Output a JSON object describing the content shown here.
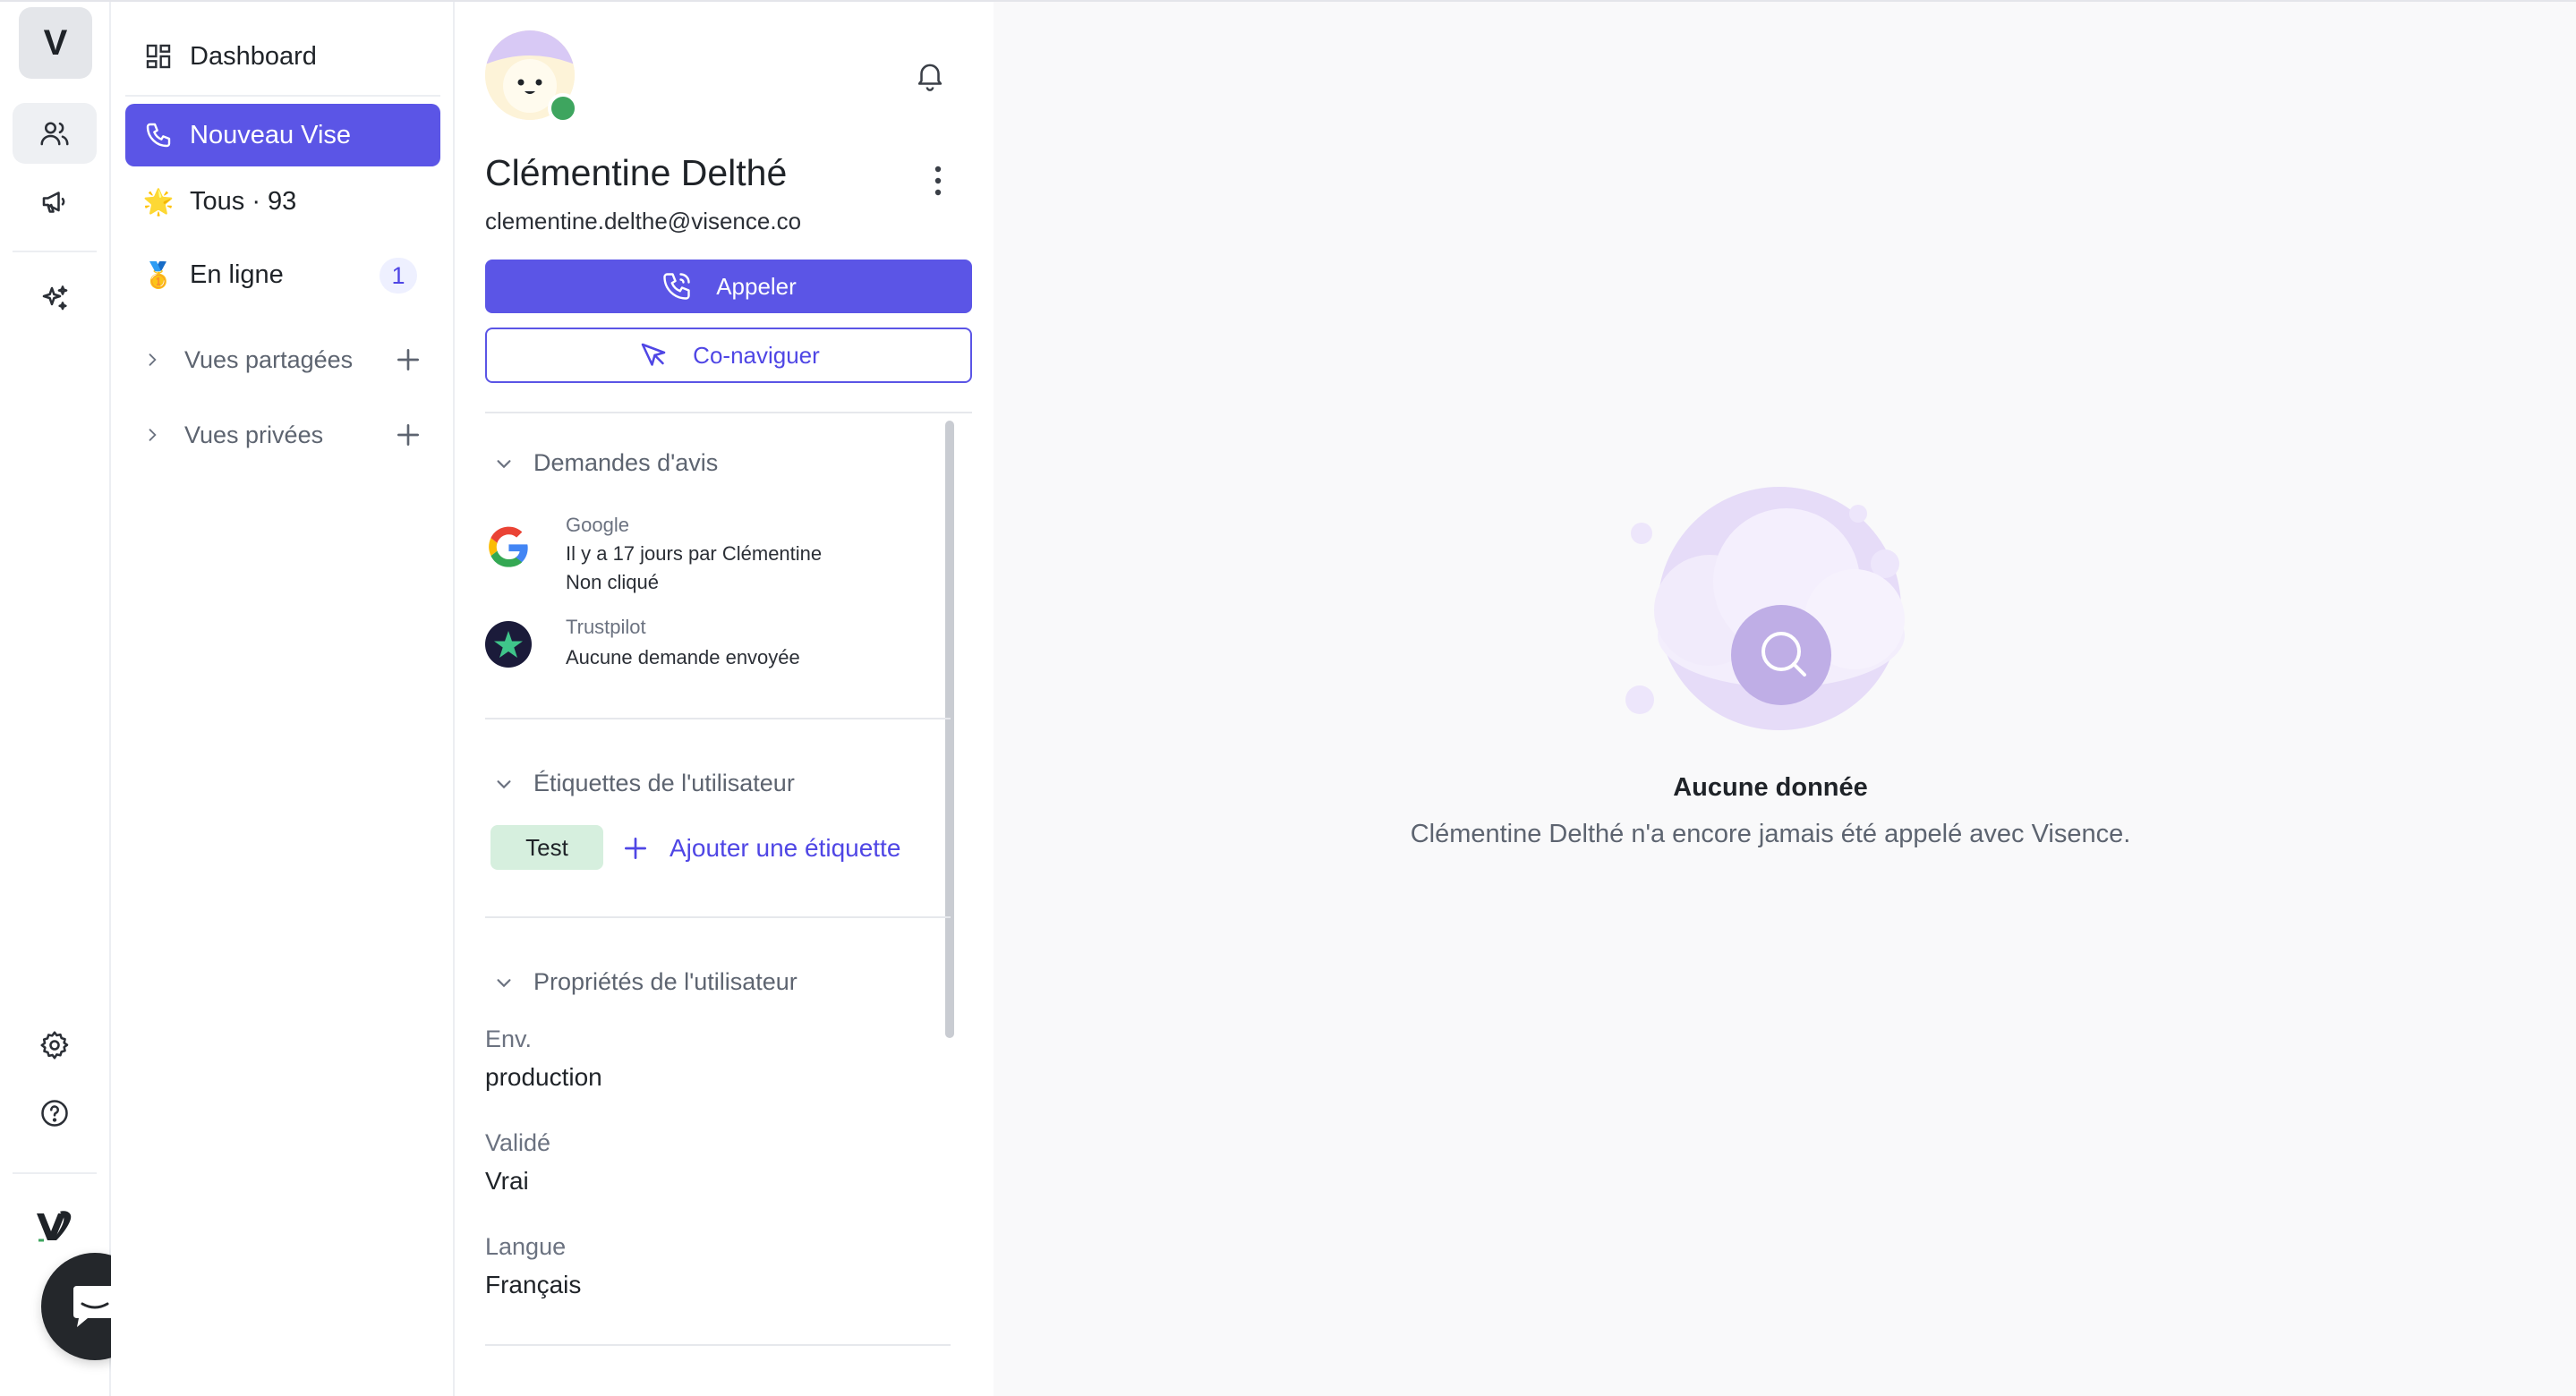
{
  "rail": {
    "logo_letter": "V",
    "icons": [
      "users-icon",
      "megaphone-icon",
      "sparkles-icon",
      "settings-icon",
      "help-icon"
    ],
    "brand_icon": "visence-logo-icon",
    "chat_icon": "chat-bubble-icon"
  },
  "nav": {
    "dashboard": "Dashboard",
    "new_vise": "Nouveau Vise",
    "all": "Tous · 93",
    "online": "En ligne",
    "online_count": "1",
    "shared_views": "Vues partagées",
    "private_views": "Vues privées",
    "all_emoji": "🌟",
    "online_emoji": "🥇"
  },
  "profile": {
    "name": "Clémentine Delthé",
    "email": "clementine.delthe@visence.co",
    "online_status_color": "#3ea55f",
    "call_label": "Appeler",
    "cobrowse_label": "Co-naviguer",
    "reviews": {
      "title": "Demandes d'avis",
      "items": [
        {
          "source": "Google",
          "line1": "Il y a 17 jours par Clémentine",
          "line2": "Non cliqué"
        },
        {
          "source": "Trustpilot",
          "line1": "Aucune demande envoyée",
          "line2": ""
        }
      ]
    },
    "tags": {
      "title": "Étiquettes de l'utilisateur",
      "items": [
        "Test"
      ],
      "add_label": "Ajouter une étiquette"
    },
    "properties": {
      "title": "Propriétés de l'utilisateur",
      "items": [
        {
          "label": "Env.",
          "value": "production"
        },
        {
          "label": "Validé",
          "value": "Vrai"
        },
        {
          "label": "Langue",
          "value": "Français"
        }
      ]
    }
  },
  "main": {
    "empty_title": "Aucune donnée",
    "empty_subtitle": "Clémentine Delthé n'a encore jamais été appelé avec Visence."
  },
  "colors": {
    "accent": "#5b55e6",
    "accent_text": "#4f46e5",
    "tag_bg": "#d6efde",
    "online": "#3ea55f"
  }
}
